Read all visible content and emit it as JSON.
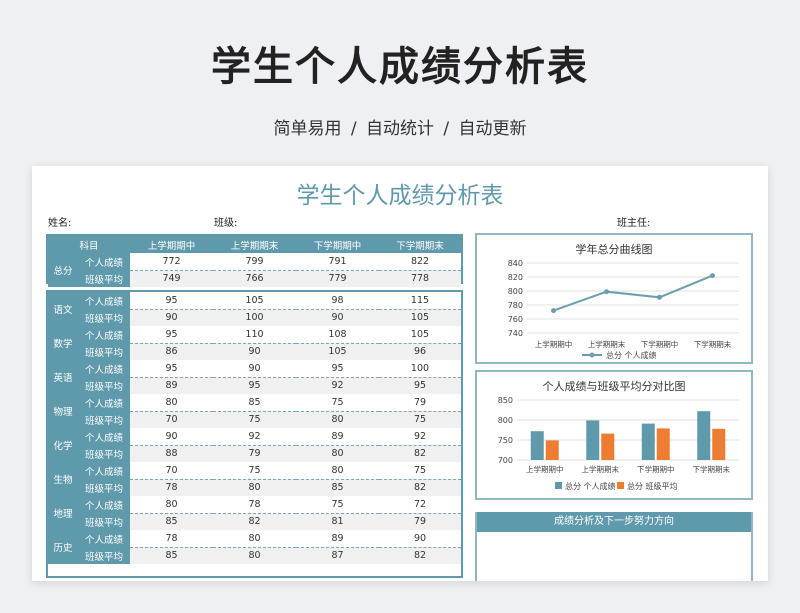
{
  "banner": {
    "title": "学生个人成绩分析表",
    "subtitle": "简单易用 / 自动统计 / 自动更新"
  },
  "sheet": {
    "title": "学生个人成绩分析表",
    "name_label": "姓名:",
    "class_label": "班级:",
    "teacher_label": "班主任:"
  },
  "table": {
    "header": [
      "科目",
      "上学期期中",
      "上学期期末",
      "下学期期中",
      "下学期期末"
    ],
    "total": {
      "subject": "总分",
      "rows": [
        {
          "label": "个人成绩",
          "values": [
            "772",
            "799",
            "791",
            "822"
          ]
        },
        {
          "label": "班级平均",
          "values": [
            "749",
            "766",
            "779",
            "778"
          ]
        }
      ]
    },
    "subjects": [
      {
        "subject": "语文",
        "rows": [
          {
            "label": "个人成绩",
            "values": [
              "95",
              "105",
              "98",
              "115"
            ]
          },
          {
            "label": "班级平均",
            "values": [
              "90",
              "100",
              "90",
              "105"
            ]
          }
        ]
      },
      {
        "subject": "数学",
        "rows": [
          {
            "label": "个人成绩",
            "values": [
              "95",
              "110",
              "108",
              "105"
            ]
          },
          {
            "label": "班级平均",
            "values": [
              "86",
              "90",
              "105",
              "96"
            ]
          }
        ]
      },
      {
        "subject": "英语",
        "rows": [
          {
            "label": "个人成绩",
            "values": [
              "95",
              "90",
              "95",
              "100"
            ]
          },
          {
            "label": "班级平均",
            "values": [
              "89",
              "95",
              "92",
              "95"
            ]
          }
        ]
      },
      {
        "subject": "物理",
        "rows": [
          {
            "label": "个人成绩",
            "values": [
              "80",
              "85",
              "75",
              "79"
            ]
          },
          {
            "label": "班级平均",
            "values": [
              "70",
              "75",
              "80",
              "75"
            ]
          }
        ]
      },
      {
        "subject": "化学",
        "rows": [
          {
            "label": "个人成绩",
            "values": [
              "90",
              "92",
              "89",
              "92"
            ]
          },
          {
            "label": "班级平均",
            "values": [
              "88",
              "79",
              "80",
              "82"
            ]
          }
        ]
      },
      {
        "subject": "生物",
        "rows": [
          {
            "label": "个人成绩",
            "values": [
              "70",
              "75",
              "80",
              "75"
            ]
          },
          {
            "label": "班级平均",
            "values": [
              "78",
              "80",
              "85",
              "82"
            ]
          }
        ]
      },
      {
        "subject": "地理",
        "rows": [
          {
            "label": "个人成绩",
            "values": [
              "80",
              "78",
              "75",
              "72"
            ]
          },
          {
            "label": "班级平均",
            "values": [
              "85",
              "82",
              "81",
              "79"
            ]
          }
        ]
      },
      {
        "subject": "历史",
        "rows": [
          {
            "label": "个人成绩",
            "values": [
              "78",
              "80",
              "89",
              "90"
            ]
          },
          {
            "label": "班级平均",
            "values": [
              "85",
              "80",
              "87",
              "82"
            ]
          }
        ]
      }
    ]
  },
  "chart_data": [
    {
      "type": "line",
      "title": "学年总分曲线图",
      "categories": [
        "上学期期中",
        "上学期期末",
        "下学期期中",
        "下学期期末"
      ],
      "series": [
        {
          "name": "总分 个人成绩",
          "values": [
            772,
            799,
            791,
            822
          ],
          "color": "#6a9fb0"
        }
      ],
      "ylim": [
        740,
        840
      ],
      "yticks": [
        740,
        760,
        780,
        800,
        820,
        840
      ],
      "grid": true,
      "legend": "bottom"
    },
    {
      "type": "bar",
      "title": "个人成绩与班级平均分对比图",
      "categories": [
        "上学期期中",
        "上学期期末",
        "下学期期中",
        "下学期期末"
      ],
      "series": [
        {
          "name": "总分 个人成绩",
          "values": [
            772,
            799,
            791,
            822
          ],
          "color": "#5f9aac"
        },
        {
          "name": "总分 班级平均",
          "values": [
            749,
            766,
            779,
            778
          ],
          "color": "#ee7d31"
        }
      ],
      "ylim": [
        700,
        850
      ],
      "yticks": [
        700,
        750,
        800,
        850
      ],
      "grid": true,
      "legend": "bottom"
    }
  ],
  "analysis": {
    "title": "成绩分析及下一步努力方向"
  }
}
